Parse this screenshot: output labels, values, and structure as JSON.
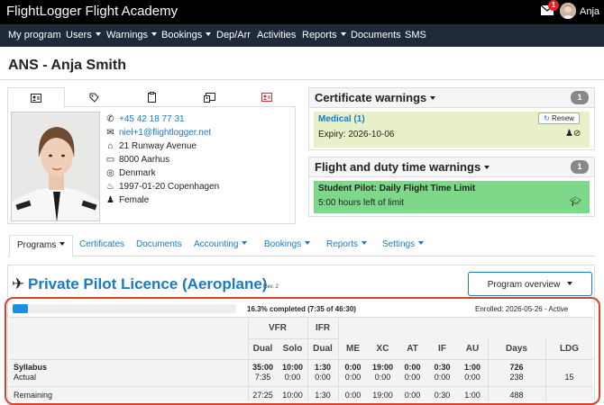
{
  "app": {
    "title": "FlightLogger Flight Academy",
    "notification_count": "1",
    "user_name": "Anja"
  },
  "nav": {
    "items": [
      {
        "label": "My program",
        "dropdown": false
      },
      {
        "label": "Users",
        "dropdown": true
      },
      {
        "label": "Warnings",
        "dropdown": true
      },
      {
        "label": "Bookings",
        "dropdown": true
      },
      {
        "label": "Dep/Arr",
        "dropdown": false
      },
      {
        "label": "Activities",
        "dropdown": false
      },
      {
        "label": "Reports",
        "dropdown": true
      },
      {
        "label": "Documents",
        "dropdown": false
      },
      {
        "label": "SMS",
        "dropdown": false
      }
    ]
  },
  "page": {
    "title": "ANS - Anja Smith"
  },
  "profile": {
    "tabs": [
      "id-card-icon",
      "tag-icon",
      "clipboard-icon",
      "id-badge-icon",
      "id-card-red-icon"
    ],
    "phone": "+45 42 18 77 31",
    "email": "niel+1@flightlogger.net",
    "address": "21 Runway Avenue",
    "city": "8000 Aarhus",
    "country": "Denmark",
    "birth": "1997-01-20 Copenhagen",
    "gender": "Female"
  },
  "certificate_warnings": {
    "title": "Certificate warnings",
    "count": "1",
    "item_title": "Medical (1)",
    "renew_label": "Renew",
    "expiry": "Expiry: 2026-10-06",
    "color": "#e8f0c8"
  },
  "duty_warnings": {
    "title": "Flight and duty time warnings",
    "count": "1",
    "item_title": "Student Pilot: Daily Flight Time Limit",
    "item_text": "5:00 hours left of limit",
    "color": "#7fd88a"
  },
  "sub_tabs": [
    {
      "label": "Programs",
      "dropdown": true,
      "active": true
    },
    {
      "label": "Certificates",
      "dropdown": false
    },
    {
      "label": "Documents",
      "dropdown": false
    },
    {
      "label": "Accounting",
      "dropdown": true
    },
    {
      "label": "Bookings",
      "dropdown": true
    },
    {
      "label": "Reports",
      "dropdown": true
    },
    {
      "label": "Settings",
      "dropdown": true
    }
  ],
  "program": {
    "title": "Private Pilot Licence (Aeroplane)",
    "revision": "Rev. 2",
    "overview_label": "Program overview",
    "progress_fraction": 0.163,
    "progress_text": "16.3% completed (7:35 of 46:30)",
    "enrolled": "Enrolled: 2026-05-26 - Active"
  },
  "table": {
    "groups": [
      "VFR",
      "IFR"
    ],
    "columns": [
      "Dual",
      "Solo",
      "Dual",
      "ME",
      "XC",
      "AT",
      "IF",
      "AU",
      "Days",
      "LDG"
    ],
    "syllabus_label": "Syllabus",
    "actual_label": "Actual",
    "remaining_label": "Remaining",
    "syllabus": [
      "35:00",
      "10:00",
      "1:30",
      "0:00",
      "19:00",
      "0:00",
      "0:30",
      "1:00",
      "726",
      ""
    ],
    "actual": [
      "7:35",
      "0:00",
      "0:00",
      "0:00",
      "0:00",
      "0:00",
      "0:00",
      "0:00",
      "238",
      "15"
    ],
    "remaining": [
      "27:25",
      "10:00",
      "1:30",
      "0:00",
      "19:00",
      "0:00",
      "0:30",
      "1:00",
      "488",
      ""
    ]
  }
}
